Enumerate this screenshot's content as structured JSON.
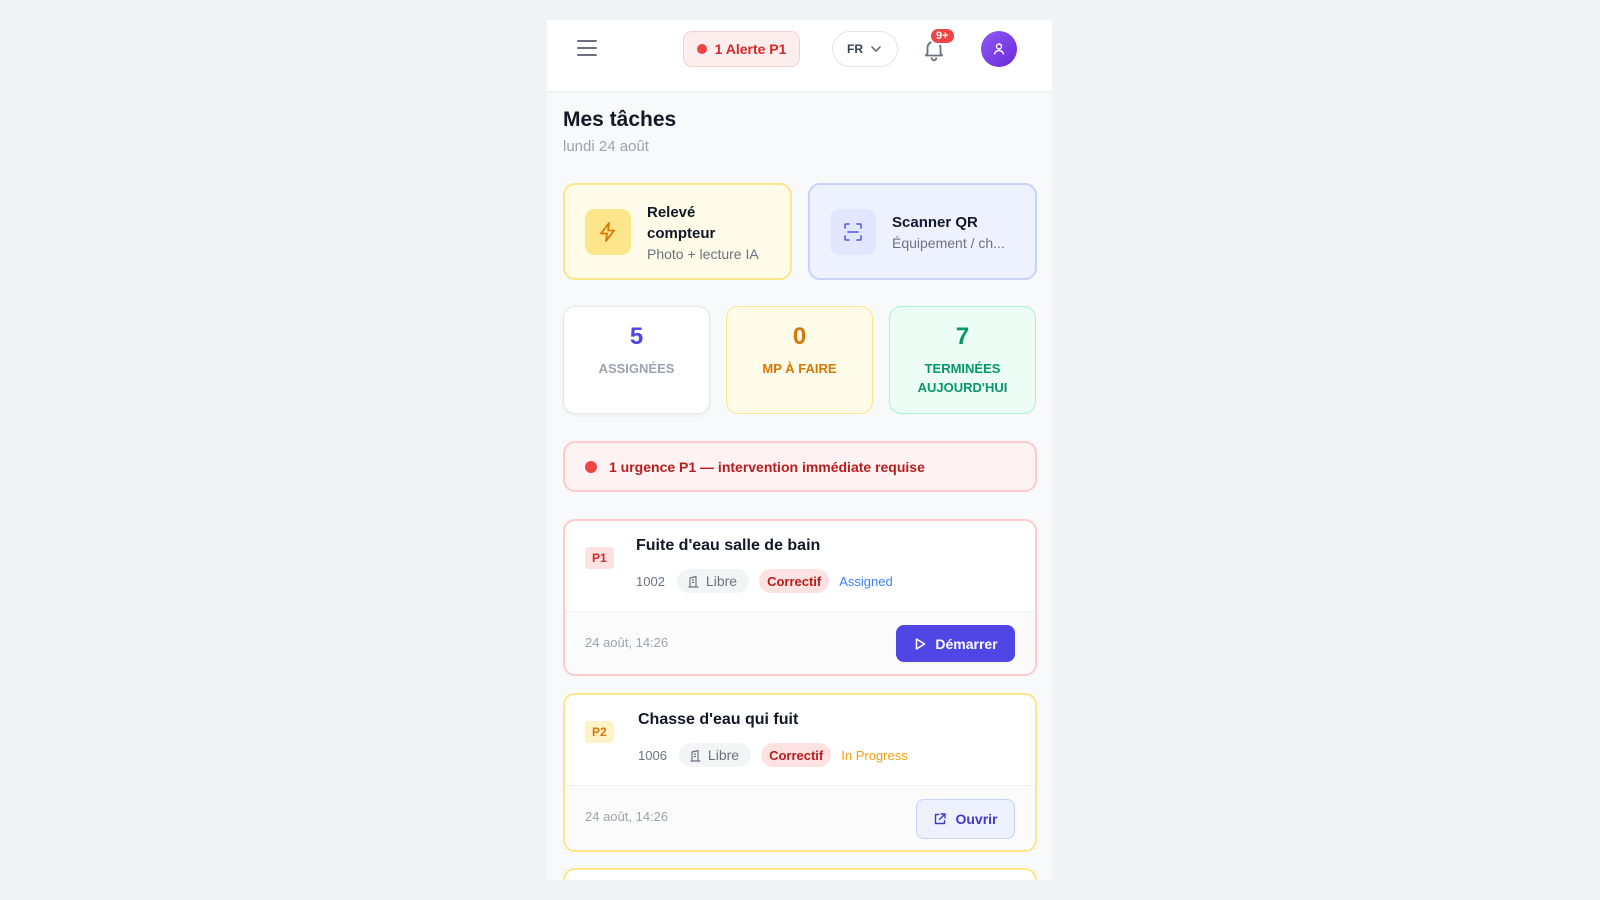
{
  "header": {
    "alert_label": "1 Alerte P1",
    "language": "FR",
    "notification_count": "9+"
  },
  "page": {
    "title": "Mes tâches",
    "date": "lundi 24 août"
  },
  "quick_actions": {
    "meter": {
      "title": "Relevé compteur",
      "subtitle": "Photo + lecture IA",
      "icon": "lightning-icon"
    },
    "scan": {
      "title": "Scanner QR",
      "subtitle": "Équipement / ch...",
      "icon": "qr-scan-icon"
    }
  },
  "stats": [
    {
      "value": "5",
      "label": "ASSIGNÉES"
    },
    {
      "value": "0",
      "label": "MP À FAIRE"
    },
    {
      "value": "7",
      "label": "TERMINÉES AUJOURD'HUI"
    }
  ],
  "urgent_banner": "1 urgence P1 — intervention immédiate requise",
  "tasks": [
    {
      "priority": "P1",
      "title": "Fuite d'eau salle de bain",
      "id": "1002",
      "location": "Libre",
      "type": "Correctif",
      "status": "Assigned",
      "time": "24 août, 14:26",
      "action": "Démarrer"
    },
    {
      "priority": "P2",
      "title": "Chasse d'eau qui fuit",
      "id": "1006",
      "location": "Libre",
      "type": "Correctif",
      "status": "In Progress",
      "time": "24 août, 14:26",
      "action": "Ouvrir"
    }
  ],
  "colors": {
    "primary": "#4f46e5",
    "danger": "#ef4444",
    "warning": "#d97706",
    "success": "#059669"
  }
}
